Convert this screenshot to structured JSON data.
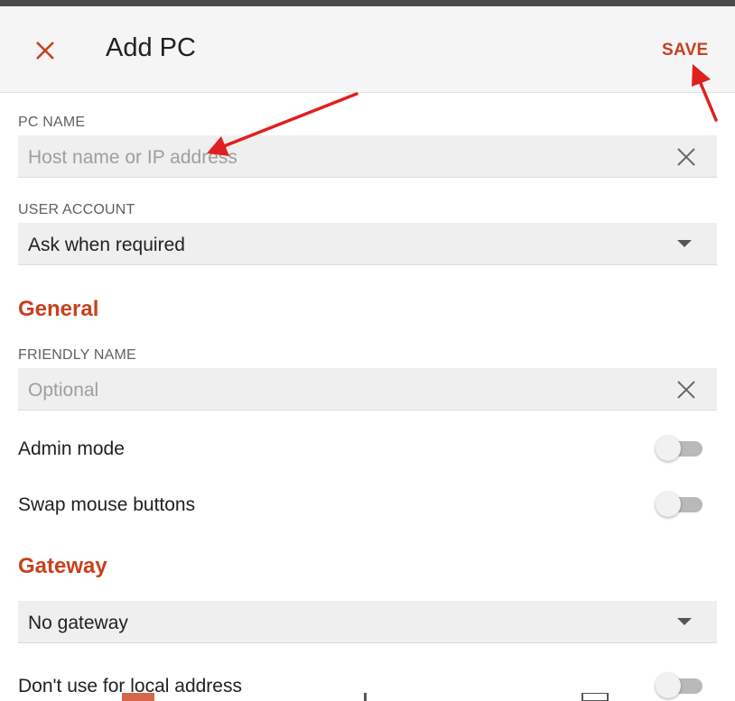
{
  "window": {
    "title": "Add PC"
  },
  "toolbar": {
    "close_icon": "close-icon",
    "save_label": "SAVE"
  },
  "pc_name": {
    "label": "PC NAME",
    "placeholder": "Host name or IP address",
    "value": ""
  },
  "user_account": {
    "label": "USER ACCOUNT",
    "value": "Ask when required"
  },
  "general": {
    "heading": "General",
    "friendly_name": {
      "label": "FRIENDLY NAME",
      "placeholder": "Optional",
      "value": ""
    },
    "admin_mode": {
      "label": "Admin mode",
      "enabled": false
    },
    "swap_mouse": {
      "label": "Swap mouse buttons",
      "enabled": false
    }
  },
  "gateway": {
    "heading": "Gateway",
    "selected": "No gateway",
    "dont_use_local": {
      "label": "Don't use for local address",
      "enabled": false
    }
  },
  "colors": {
    "accent": "#c8401e",
    "annotation_arrow": "#e02020",
    "field_bg": "#efefef",
    "appbar_bg": "#f5f5f5"
  }
}
